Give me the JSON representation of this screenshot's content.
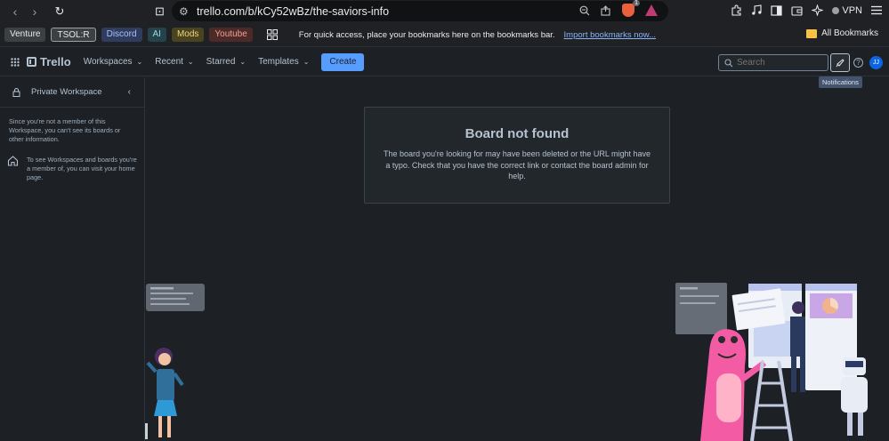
{
  "browser": {
    "back_glyph": "‹",
    "forward_glyph": "›",
    "reload_glyph": "↻",
    "bookmark_glyph": "⊡",
    "tune_glyph": "⚙",
    "url": "trello.com/b/kCy52wBz/the-saviors-info",
    "shield_count": "1",
    "vpn_label": "VPN",
    "icons": [
      "zoom-icon",
      "share-icon",
      "brave-shields-icon",
      "brave-rewards-icon",
      "extensions-icon",
      "media-icon",
      "sidebar-icon",
      "wallet-icon",
      "leo-icon",
      "menu-icon"
    ]
  },
  "bookmarks": {
    "chips": [
      {
        "label": "Venture",
        "bg": "#3c4043",
        "fg": "#e8eaed"
      },
      {
        "label": "TSOL:R",
        "bg": "#3c4043",
        "fg": "#e8eaed",
        "border": "#9aa0a6"
      },
      {
        "label": "Discord",
        "bg": "#2f3c5e",
        "fg": "#a8c0ff"
      },
      {
        "label": "AI",
        "bg": "#24434a",
        "fg": "#9fd8e4"
      },
      {
        "label": "Mods",
        "bg": "#4a4320",
        "fg": "#f0d77c"
      },
      {
        "label": "Youtube",
        "bg": "#4c2a27",
        "fg": "#f2a096"
      }
    ],
    "message": "For quick access, place your bookmarks here on the bookmarks bar.",
    "import_link": "Import bookmarks now...",
    "all_bookmarks": "All Bookmarks"
  },
  "header": {
    "logo": "Trello",
    "menus": [
      "Workspaces",
      "Recent",
      "Starred",
      "Templates"
    ],
    "create_label": "Create",
    "search_placeholder": "Search",
    "avatar_initials": "JJ",
    "notifications_tooltip": "Notifications"
  },
  "sidebar": {
    "workspace_name": "Private Workspace",
    "note1": "Since you're not a member of this Workspace, you can't see its boards or other information.",
    "note2": "To see Workspaces and boards you're a member of, you can visit your home page."
  },
  "main": {
    "title": "Board not found",
    "body": "The board you're looking for may have been deleted or the URL might have a typo. Check that you have the correct link or contact the board admin for help."
  },
  "colors": {
    "background": "#1d2125",
    "accent": "#579dff",
    "text": "#b6c2cf"
  }
}
